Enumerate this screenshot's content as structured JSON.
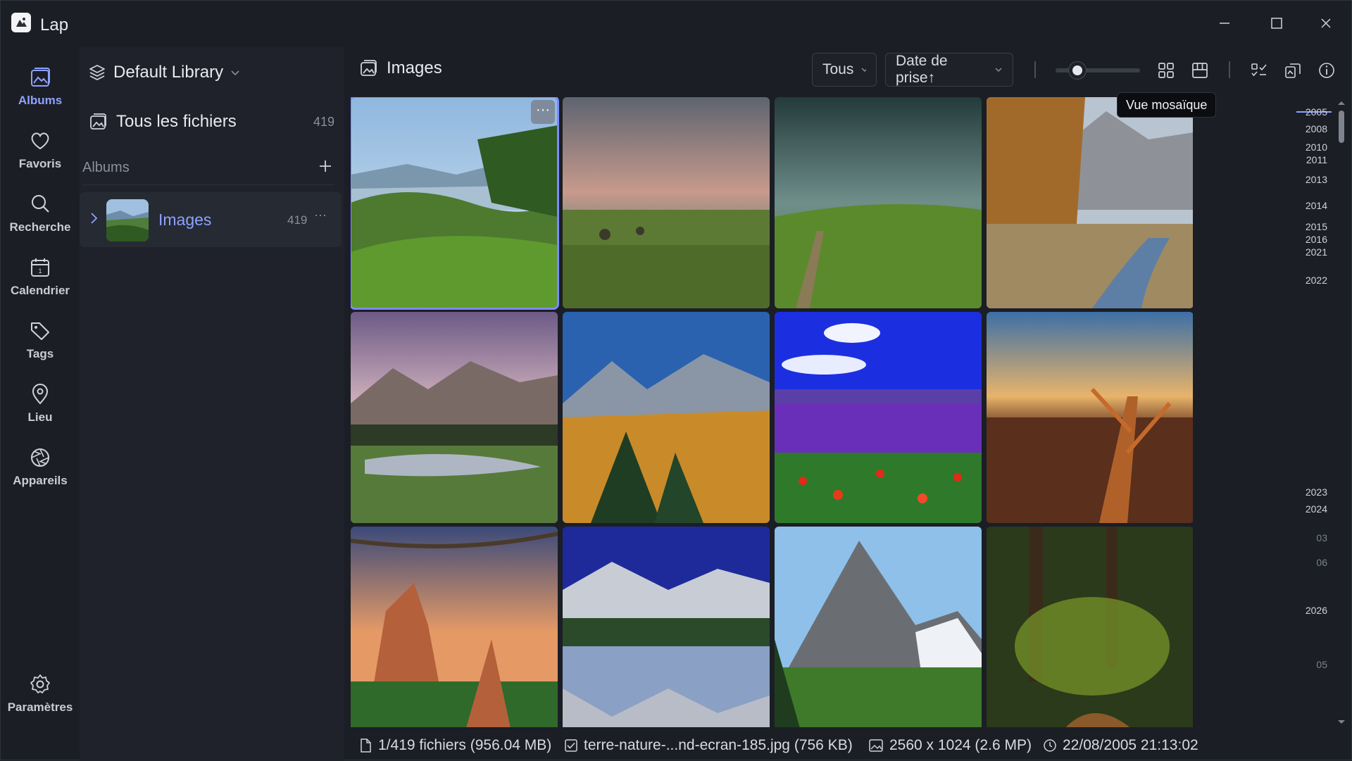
{
  "window": {
    "title": "Lap"
  },
  "nav": [
    {
      "label": "Albums",
      "icon": "albums-icon",
      "active": true
    },
    {
      "label": "Favoris",
      "icon": "heart-icon"
    },
    {
      "label": "Recherche",
      "icon": "search-icon"
    },
    {
      "label": "Calendrier",
      "icon": "calendar-icon"
    },
    {
      "label": "Tags",
      "icon": "tag-icon"
    },
    {
      "label": "Lieu",
      "icon": "location-pin-icon"
    },
    {
      "label": "Appareils",
      "icon": "aperture-icon"
    },
    {
      "label": "Paramètres",
      "icon": "gear-icon"
    }
  ],
  "library": {
    "name": "Default Library"
  },
  "all_files": {
    "label": "Tous les fichiers",
    "count": "419"
  },
  "albums_section": {
    "label": "Albums"
  },
  "albums": [
    {
      "name": "Images",
      "count": "419",
      "more": "···"
    }
  ],
  "toolbar": {
    "title": "Images",
    "filter": "Tous",
    "sort": "Date de prise↑",
    "tooltip": "Vue mosaïque",
    "thumb_size_level": 0.2
  },
  "tiles_more": "···",
  "timeline": [
    {
      "label": "2005",
      "active": true
    },
    {
      "label": "2008"
    },
    {
      "label": "2010"
    },
    {
      "label": "2011"
    },
    {
      "label": "2013"
    },
    {
      "label": "2014"
    },
    {
      "label": "2015"
    },
    {
      "label": "2016"
    },
    {
      "label": "2021"
    },
    {
      "label": "2022"
    },
    {
      "label": "2023"
    },
    {
      "label": "2024"
    },
    {
      "label": "03",
      "dim": true
    },
    {
      "label": "06",
      "dim": true
    },
    {
      "label": "2026"
    },
    {
      "label": "05",
      "dim": true
    }
  ],
  "status": {
    "files": "1/419 fichiers (956.04 MB)",
    "filename": "terre-nature-...nd-ecran-185.jpg (756 KB)",
    "dimensions": "2560 x 1024 (2.6 MP)",
    "date": "22/08/2005 21:13:02"
  },
  "colors": {
    "accent": "#8ea2ff",
    "background": "#1b1e25",
    "panel": "#1f222a",
    "selection": "#7b8cff"
  }
}
